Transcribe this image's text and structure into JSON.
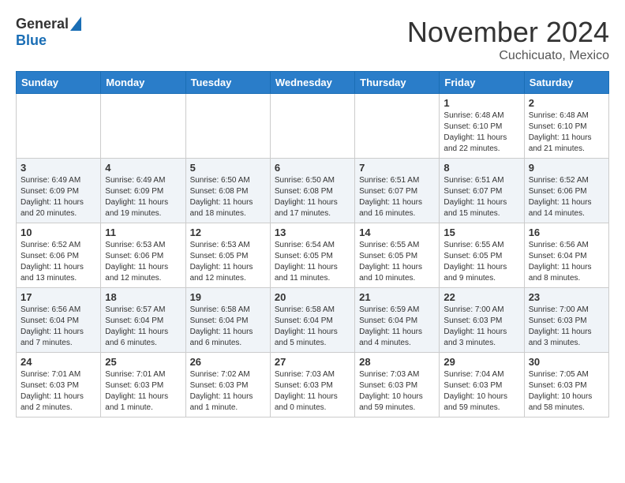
{
  "header": {
    "logo_general": "General",
    "logo_blue": "Blue",
    "month_title": "November 2024",
    "location": "Cuchicuato, Mexico"
  },
  "calendar": {
    "days_of_week": [
      "Sunday",
      "Monday",
      "Tuesday",
      "Wednesday",
      "Thursday",
      "Friday",
      "Saturday"
    ],
    "weeks": [
      [
        {
          "day": "",
          "info": ""
        },
        {
          "day": "",
          "info": ""
        },
        {
          "day": "",
          "info": ""
        },
        {
          "day": "",
          "info": ""
        },
        {
          "day": "",
          "info": ""
        },
        {
          "day": "1",
          "info": "Sunrise: 6:48 AM\nSunset: 6:10 PM\nDaylight: 11 hours and 22 minutes."
        },
        {
          "day": "2",
          "info": "Sunrise: 6:48 AM\nSunset: 6:10 PM\nDaylight: 11 hours and 21 minutes."
        }
      ],
      [
        {
          "day": "3",
          "info": "Sunrise: 6:49 AM\nSunset: 6:09 PM\nDaylight: 11 hours and 20 minutes."
        },
        {
          "day": "4",
          "info": "Sunrise: 6:49 AM\nSunset: 6:09 PM\nDaylight: 11 hours and 19 minutes."
        },
        {
          "day": "5",
          "info": "Sunrise: 6:50 AM\nSunset: 6:08 PM\nDaylight: 11 hours and 18 minutes."
        },
        {
          "day": "6",
          "info": "Sunrise: 6:50 AM\nSunset: 6:08 PM\nDaylight: 11 hours and 17 minutes."
        },
        {
          "day": "7",
          "info": "Sunrise: 6:51 AM\nSunset: 6:07 PM\nDaylight: 11 hours and 16 minutes."
        },
        {
          "day": "8",
          "info": "Sunrise: 6:51 AM\nSunset: 6:07 PM\nDaylight: 11 hours and 15 minutes."
        },
        {
          "day": "9",
          "info": "Sunrise: 6:52 AM\nSunset: 6:06 PM\nDaylight: 11 hours and 14 minutes."
        }
      ],
      [
        {
          "day": "10",
          "info": "Sunrise: 6:52 AM\nSunset: 6:06 PM\nDaylight: 11 hours and 13 minutes."
        },
        {
          "day": "11",
          "info": "Sunrise: 6:53 AM\nSunset: 6:06 PM\nDaylight: 11 hours and 12 minutes."
        },
        {
          "day": "12",
          "info": "Sunrise: 6:53 AM\nSunset: 6:05 PM\nDaylight: 11 hours and 12 minutes."
        },
        {
          "day": "13",
          "info": "Sunrise: 6:54 AM\nSunset: 6:05 PM\nDaylight: 11 hours and 11 minutes."
        },
        {
          "day": "14",
          "info": "Sunrise: 6:55 AM\nSunset: 6:05 PM\nDaylight: 11 hours and 10 minutes."
        },
        {
          "day": "15",
          "info": "Sunrise: 6:55 AM\nSunset: 6:05 PM\nDaylight: 11 hours and 9 minutes."
        },
        {
          "day": "16",
          "info": "Sunrise: 6:56 AM\nSunset: 6:04 PM\nDaylight: 11 hours and 8 minutes."
        }
      ],
      [
        {
          "day": "17",
          "info": "Sunrise: 6:56 AM\nSunset: 6:04 PM\nDaylight: 11 hours and 7 minutes."
        },
        {
          "day": "18",
          "info": "Sunrise: 6:57 AM\nSunset: 6:04 PM\nDaylight: 11 hours and 6 minutes."
        },
        {
          "day": "19",
          "info": "Sunrise: 6:58 AM\nSunset: 6:04 PM\nDaylight: 11 hours and 6 minutes."
        },
        {
          "day": "20",
          "info": "Sunrise: 6:58 AM\nSunset: 6:04 PM\nDaylight: 11 hours and 5 minutes."
        },
        {
          "day": "21",
          "info": "Sunrise: 6:59 AM\nSunset: 6:04 PM\nDaylight: 11 hours and 4 minutes."
        },
        {
          "day": "22",
          "info": "Sunrise: 7:00 AM\nSunset: 6:03 PM\nDaylight: 11 hours and 3 minutes."
        },
        {
          "day": "23",
          "info": "Sunrise: 7:00 AM\nSunset: 6:03 PM\nDaylight: 11 hours and 3 minutes."
        }
      ],
      [
        {
          "day": "24",
          "info": "Sunrise: 7:01 AM\nSunset: 6:03 PM\nDaylight: 11 hours and 2 minutes."
        },
        {
          "day": "25",
          "info": "Sunrise: 7:01 AM\nSunset: 6:03 PM\nDaylight: 11 hours and 1 minute."
        },
        {
          "day": "26",
          "info": "Sunrise: 7:02 AM\nSunset: 6:03 PM\nDaylight: 11 hours and 1 minute."
        },
        {
          "day": "27",
          "info": "Sunrise: 7:03 AM\nSunset: 6:03 PM\nDaylight: 11 hours and 0 minutes."
        },
        {
          "day": "28",
          "info": "Sunrise: 7:03 AM\nSunset: 6:03 PM\nDaylight: 10 hours and 59 minutes."
        },
        {
          "day": "29",
          "info": "Sunrise: 7:04 AM\nSunset: 6:03 PM\nDaylight: 10 hours and 59 minutes."
        },
        {
          "day": "30",
          "info": "Sunrise: 7:05 AM\nSunset: 6:03 PM\nDaylight: 10 hours and 58 minutes."
        }
      ]
    ]
  }
}
